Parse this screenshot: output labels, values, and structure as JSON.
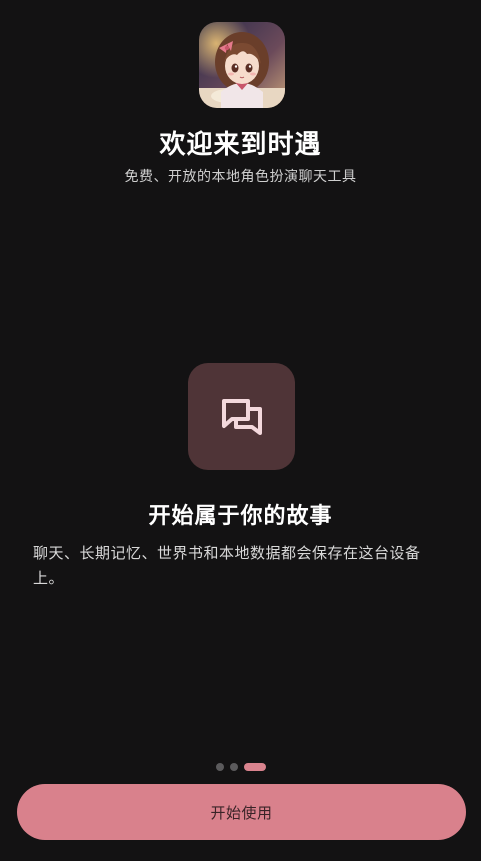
{
  "header": {
    "app_icon": "anime-girl-avatar-icon",
    "title": "欢迎来到时遇",
    "subtitle": "免费、开放的本地角色扮演聊天工具"
  },
  "feature": {
    "icon": "chat-bubbles-icon",
    "title": "开始属于你的故事",
    "description": "聊天、长期记忆、世界书和本地数据都会保存在这台设备上。"
  },
  "pager": {
    "total": 3,
    "active_index": 2
  },
  "start_button": {
    "label": "开始使用"
  },
  "colors": {
    "background": "#131213",
    "accent": "#d9818c",
    "icon_tile": "#4f3437"
  }
}
